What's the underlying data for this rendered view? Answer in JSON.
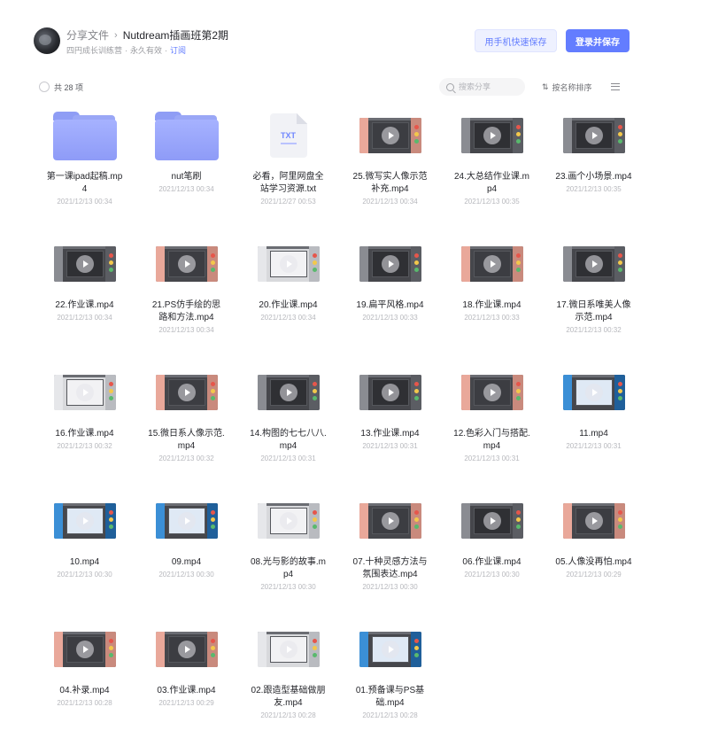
{
  "header": {
    "breadcrumb_root": "分享文件",
    "breadcrumb_sep": "›",
    "title": "Nutdream插画班第2期",
    "owner": "四円成长训练营",
    "validity": "永久有效",
    "subscribe": "订阅",
    "btn_phone": "用手机快速保存",
    "btn_login": "登录并保存"
  },
  "toolbar": {
    "count": "共 28 项",
    "search_placeholder": "搜索分享",
    "sort_label": "按名称排序",
    "sort_icon": "⇅"
  },
  "colors": {
    "accent": "#637dff",
    "folder": "#9aa7f6"
  },
  "files": [
    {
      "type": "folder",
      "name": "第一课ipad起稿.mp4",
      "date": "2021/12/13 00:34"
    },
    {
      "type": "folder",
      "name": "nut笔刷",
      "date": "2021/12/13 00:34"
    },
    {
      "type": "txt",
      "name": "必看，阿里网盘全站学习资源.txt",
      "date": "2021/12/27 00:53",
      "icon_text": "TXT"
    },
    {
      "type": "video",
      "name": "25.微写实人像示范补充.mp4",
      "date": "2021/12/13 00:34",
      "thumb": "pink"
    },
    {
      "type": "video",
      "name": "24.大总结作业课.mp4",
      "date": "2021/12/13 00:35",
      "thumb": "gray"
    },
    {
      "type": "video",
      "name": "23.画个小场景.mp4",
      "date": "2021/12/13 00:35",
      "thumb": "gray"
    },
    {
      "type": "video",
      "name": "22.作业课.mp4",
      "date": "2021/12/13 00:34",
      "thumb": "gray"
    },
    {
      "type": "video",
      "name": "21.PS仿手绘的思路和方法.mp4",
      "date": "2021/12/13 00:34",
      "thumb": "pink"
    },
    {
      "type": "video",
      "name": "20.作业课.mp4",
      "date": "2021/12/13 00:34",
      "thumb": "light"
    },
    {
      "type": "video",
      "name": "19.扁平风格.mp4",
      "date": "2021/12/13 00:33",
      "thumb": "gray"
    },
    {
      "type": "video",
      "name": "18.作业课.mp4",
      "date": "2021/12/13 00:33",
      "thumb": "pink"
    },
    {
      "type": "video",
      "name": "17.微日系唯美人像示范.mp4",
      "date": "2021/12/13 00:32",
      "thumb": "gray"
    },
    {
      "type": "video",
      "name": "16.作业课.mp4",
      "date": "2021/12/13 00:32",
      "thumb": "light"
    },
    {
      "type": "video",
      "name": "15.微日系人像示范.mp4",
      "date": "2021/12/13 00:32",
      "thumb": "pink"
    },
    {
      "type": "video",
      "name": "14.构图的七七八八.mp4",
      "date": "2021/12/13 00:31",
      "thumb": "gray"
    },
    {
      "type": "video",
      "name": "13.作业课.mp4",
      "date": "2021/12/13 00:31",
      "thumb": "gray"
    },
    {
      "type": "video",
      "name": "12.色彩入门与搭配.mp4",
      "date": "2021/12/13 00:31",
      "thumb": "pink"
    },
    {
      "type": "video",
      "name": "11.mp4",
      "date": "2021/12/13 00:31",
      "thumb": "blue"
    },
    {
      "type": "video",
      "name": "10.mp4",
      "date": "2021/12/13 00:30",
      "thumb": "blue"
    },
    {
      "type": "video",
      "name": "09.mp4",
      "date": "2021/12/13 00:30",
      "thumb": "blue"
    },
    {
      "type": "video",
      "name": "08.光与影的故事.mp4",
      "date": "2021/12/13 00:30",
      "thumb": "light"
    },
    {
      "type": "video",
      "name": "07.十种灵感方法与氛围表达.mp4",
      "date": "2021/12/13 00:30",
      "thumb": "pink"
    },
    {
      "type": "video",
      "name": "06.作业课.mp4",
      "date": "2021/12/13 00:30",
      "thumb": "gray"
    },
    {
      "type": "video",
      "name": "05.人像没再怕.mp4",
      "date": "2021/12/13 00:29",
      "thumb": "pink"
    },
    {
      "type": "video",
      "name": "04.补录.mp4",
      "date": "2021/12/13 00:28",
      "thumb": "pink"
    },
    {
      "type": "video",
      "name": "03.作业课.mp4",
      "date": "2021/12/13 00:29",
      "thumb": "pink"
    },
    {
      "type": "video",
      "name": "02.跟造型基础做朋友.mp4",
      "date": "2021/12/13 00:28",
      "thumb": "light"
    },
    {
      "type": "video",
      "name": "01.预备课与PS基础.mp4",
      "date": "2021/12/13 00:28",
      "thumb": "blue"
    }
  ]
}
